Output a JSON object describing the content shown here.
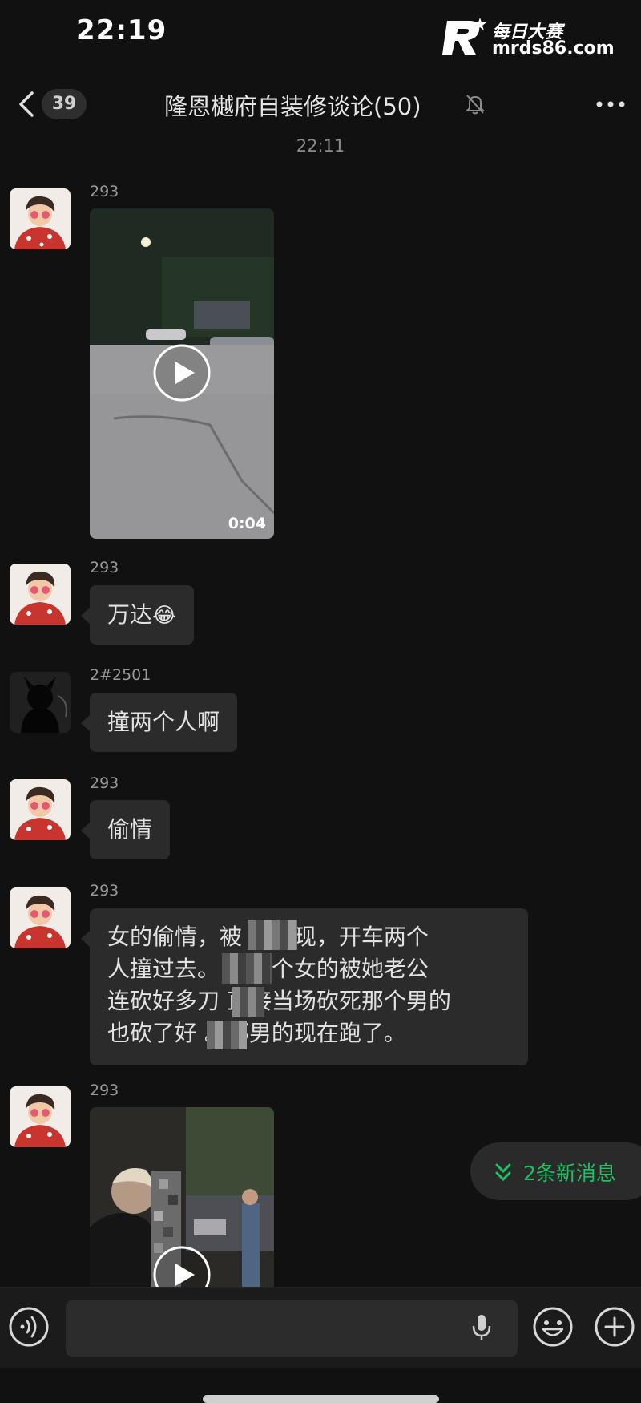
{
  "status_bar": {
    "time": "22:19"
  },
  "watermark": {
    "name": "每日大赛",
    "url": "mrds86.com"
  },
  "navbar": {
    "unread_count": "39",
    "title": "隆恩樾府自装修谈论(50)"
  },
  "time_separator": "22:11",
  "messages": [
    {
      "sender": "293",
      "type": "video",
      "duration": "0:04"
    },
    {
      "sender": "293",
      "type": "text",
      "text": "万达",
      "emoji": "😂"
    },
    {
      "sender": "2#2501",
      "type": "text",
      "text": "撞两个人啊"
    },
    {
      "sender": "293",
      "type": "text",
      "text": "偷情"
    },
    {
      "sender": "293",
      "type": "text",
      "lines": [
        "女的偷情，被    公发现，开车两个",
        "人撞过去。      ，那个女的被她老公",
        "连砍好多刀    直接当场砍死那个男的",
        "也砍了好    。那男的现在跑了。"
      ]
    },
    {
      "sender": "293",
      "type": "video"
    }
  ],
  "new_messages_pill": {
    "label": "2条新消息"
  },
  "input_bar": {
    "placeholder": ""
  },
  "colors": {
    "background": "#111111",
    "bubble": "#2b2b2b",
    "accent_green": "#1fbf62"
  }
}
